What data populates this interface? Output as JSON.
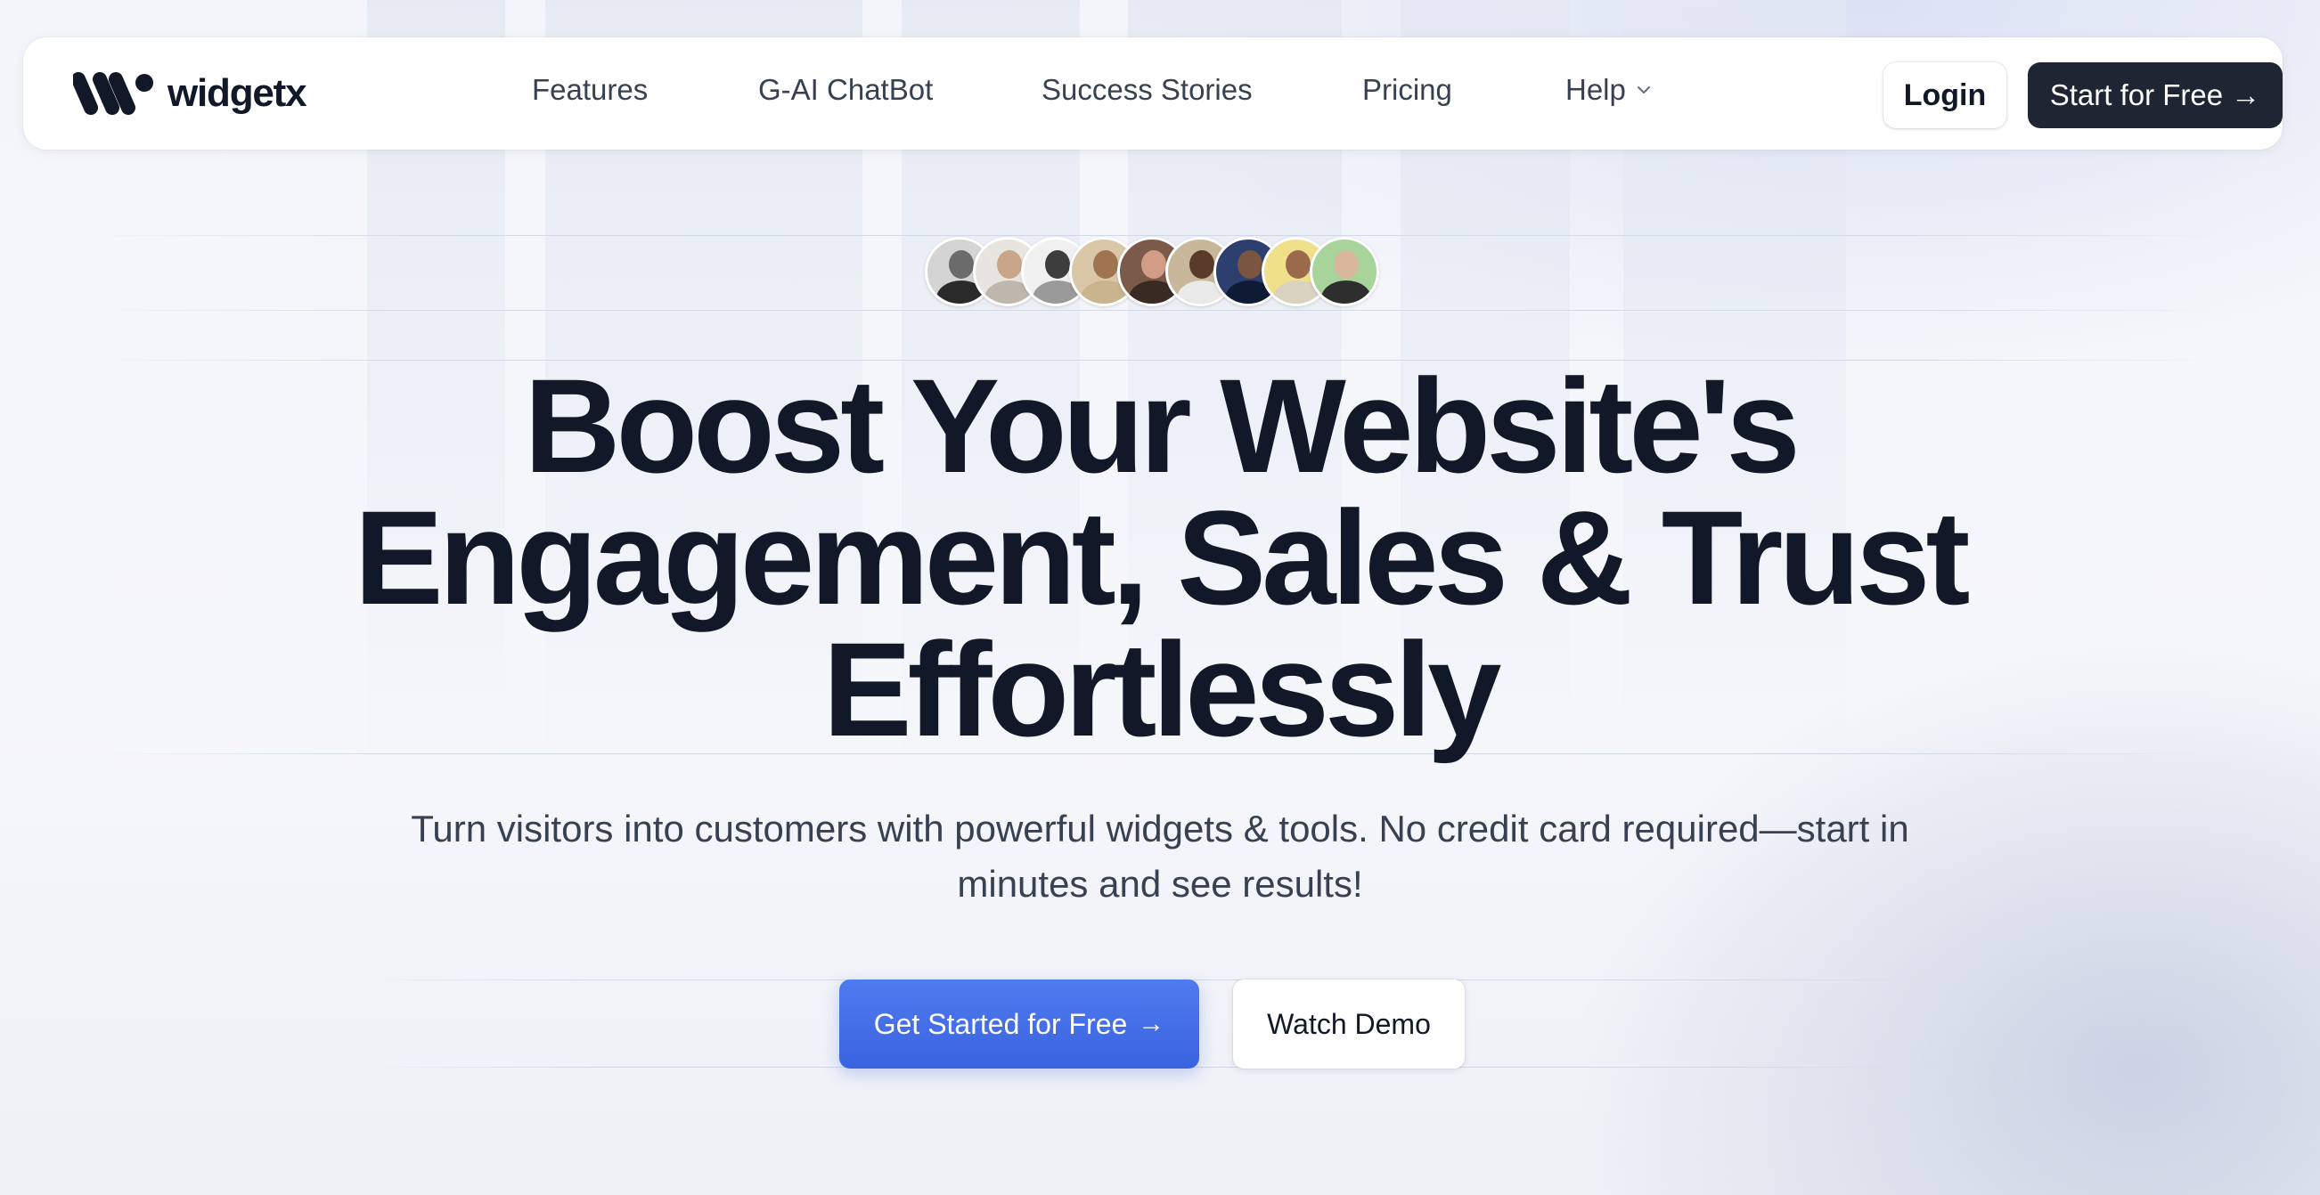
{
  "brand": {
    "name": "widgetx",
    "logo_icon": "widgetx-logo-icon"
  },
  "nav": {
    "links": [
      {
        "label": "Features"
      },
      {
        "label": "G-AI ChatBot"
      },
      {
        "label": "Success Stories"
      },
      {
        "label": "Pricing"
      },
      {
        "label": "Help",
        "icon": "chevron-down-icon"
      }
    ],
    "login_label": "Login",
    "start_label": "Start for Free →"
  },
  "avatars": {
    "count": 9
  },
  "hero": {
    "headline_line1": "Boost Your Website's",
    "headline_line2": "Engagement, Sales & Trust",
    "headline_line3": "Effortlessly",
    "subtitle": "Turn visitors into customers with powerful widgets & tools. No credit card required—start in minutes and see results!",
    "primary_cta_label": "Get Started for Free",
    "primary_cta_icon": "arrow-right-icon",
    "secondary_cta_label": "Watch Demo"
  },
  "colors": {
    "primary": "#3a63e0",
    "dark_button": "#1f2633",
    "text": "#111827"
  }
}
